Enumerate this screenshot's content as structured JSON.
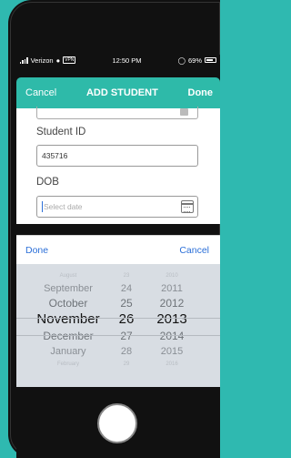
{
  "status": {
    "carrier": "Verizon",
    "vpn": "VPN",
    "time": "12:50 PM",
    "battery": "69%"
  },
  "nav": {
    "cancel": "Cancel",
    "title": "ADD STUDENT",
    "done": "Done"
  },
  "form": {
    "student_id_label": "Student ID",
    "student_id_value": "435716",
    "dob_label": "DOB",
    "dob_placeholder": "Select date"
  },
  "picker_toolbar": {
    "done": "Done",
    "cancel": "Cancel"
  },
  "picker": {
    "months": [
      "August",
      "September",
      "October",
      "November",
      "December",
      "January",
      "February"
    ],
    "days": [
      "23",
      "24",
      "25",
      "26",
      "27",
      "28",
      "29"
    ],
    "years": [
      "2010",
      "2011",
      "2012",
      "2013",
      "2014",
      "2015",
      "2016"
    ],
    "selected": {
      "month": "November",
      "day": "26",
      "year": "2013"
    }
  },
  "colors": {
    "accent": "#2ebaa9",
    "link": "#2b6fd8"
  }
}
